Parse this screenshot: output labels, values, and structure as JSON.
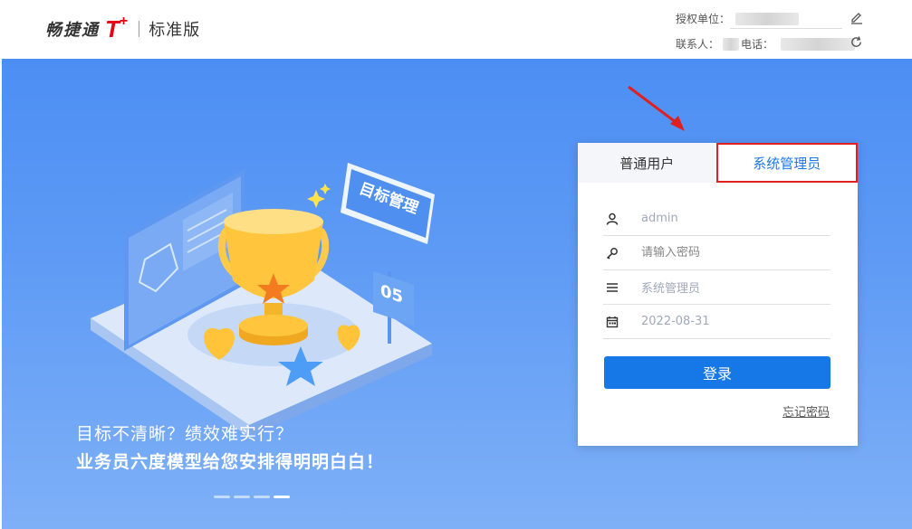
{
  "header": {
    "logo_brand": "畅捷通",
    "logo_t": "T",
    "logo_plus": "+",
    "edition": "标准版",
    "license_label": "授权单位：",
    "contact_label": "联系人：",
    "phone_label": "电话："
  },
  "hero": {
    "badge_text": "目标管理",
    "flag_number": "05",
    "slogan_line1": "目标不清晰？绩效难实行？",
    "slogan_line2": "业务员六度模型给您安排得明明白白！",
    "carousel_dots": 4,
    "active_dot": 3
  },
  "login": {
    "tabs": [
      {
        "label": "普通用户",
        "active": false
      },
      {
        "label": "系统管理员",
        "active": true
      }
    ],
    "username_value": "admin",
    "password_placeholder": "请输入密码",
    "role_value": "系统管理员",
    "date_value": "2022-08-31",
    "login_label": "登录",
    "forgot_label": "忘记密码"
  },
  "colors": {
    "accent": "#1677e6",
    "brand_red": "#e60012",
    "highlight_border": "#e02020",
    "hero_top": "#4c8ef3",
    "hero_bottom": "#7eb0f7"
  }
}
